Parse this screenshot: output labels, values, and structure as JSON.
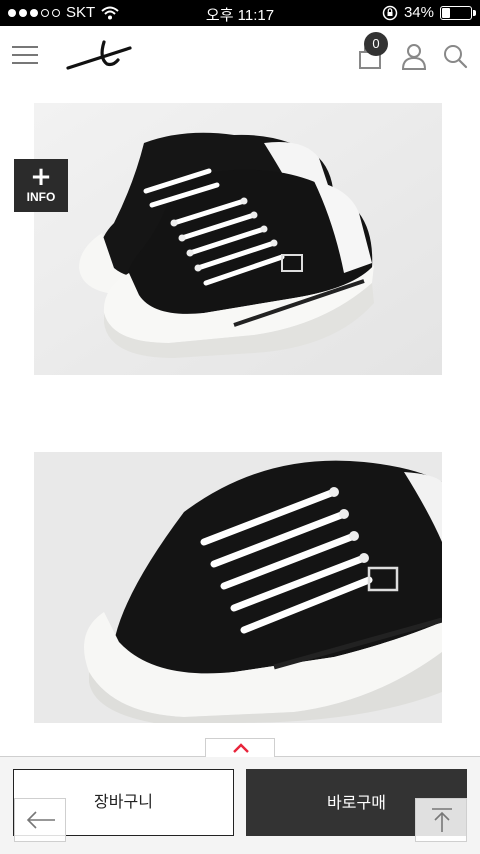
{
  "status_bar": {
    "carrier": "SKT",
    "time": "오후 11:17",
    "battery": "34%",
    "battery_level": 0.34
  },
  "header": {
    "cart_count": "0",
    "icons": [
      "menu-icon",
      "brand-logo",
      "bag-icon",
      "user-icon",
      "search-icon"
    ]
  },
  "product": {
    "info_label": "INFO",
    "info_plus": "+"
  },
  "actions": {
    "cart_label": "장바구니",
    "buy_label": "바로구매"
  },
  "colors": {
    "accent_red": "#e8243b",
    "dark_button": "#333333",
    "sneaker_black": "#161616",
    "sole_white": "#f6f6f4"
  }
}
